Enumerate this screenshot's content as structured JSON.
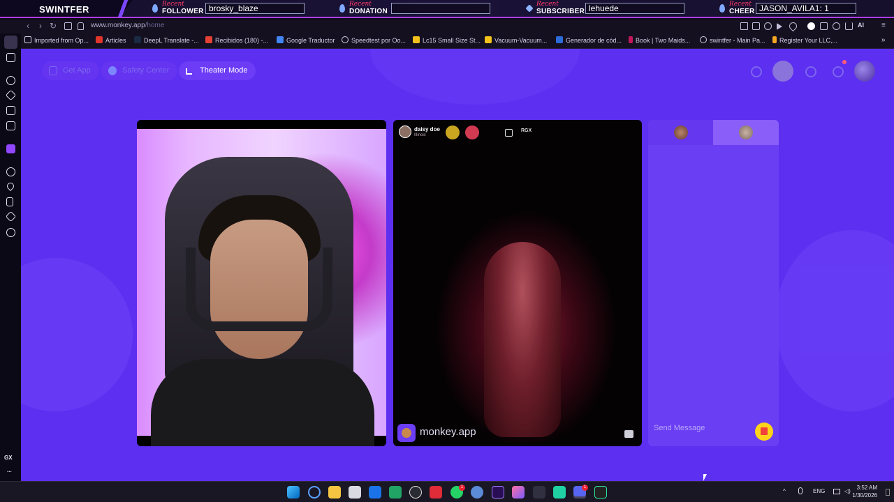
{
  "overlay": {
    "brand": "SWINTFER",
    "items": [
      {
        "tag": "Recent",
        "kind": "FOLLOWER",
        "value": "brosky_blaze"
      },
      {
        "tag": "Recent",
        "kind": "DONATION",
        "value": ""
      },
      {
        "tag": "Recent",
        "kind": "SUBSCRIBER",
        "value": "lehuede"
      },
      {
        "tag": "Recent",
        "kind": "CHEER",
        "value": "JASON_AVILA1: 1"
      }
    ]
  },
  "browser": {
    "url_host": "www.monkey.app",
    "url_path": "/home",
    "ai_label": "AI",
    "bookmarks": [
      "Imported from Op...",
      "Articles",
      "DeepL Translate -...",
      "Recibidos (180) -...",
      "Google Traductor",
      "Speedtest por Oo...",
      "Lc15 Small Size St...",
      "Vacuum-Vacuum...",
      "Generador de cód...",
      "Book | Two Maids...",
      "swintfer - Main Pa...",
      "Register Your LLC,..."
    ],
    "sidebar_gx_label": "GX",
    "sidebar_more_label": "..."
  },
  "page": {
    "nav": {
      "get_app": "Get App",
      "safety_center": "Safety Center",
      "theater_mode": "Theater Mode"
    },
    "peer": {
      "name": "daisy doe",
      "location": "Illinois",
      "rgx_label": "RGX"
    },
    "brand_watermark": "monkey.app",
    "chat": {
      "placeholder": "Send Message"
    }
  },
  "taskbar": {
    "language": "ENG",
    "time": "3:52 AM",
    "date": "1/30/2026",
    "whatsapp_badge": "1",
    "discord_badge": "1"
  },
  "colors": {
    "page_background": "#5d2ff0",
    "chat_panel": "#6a3ef3",
    "overlay_accent": "#b23cff",
    "gift_button": "#ffd319"
  }
}
